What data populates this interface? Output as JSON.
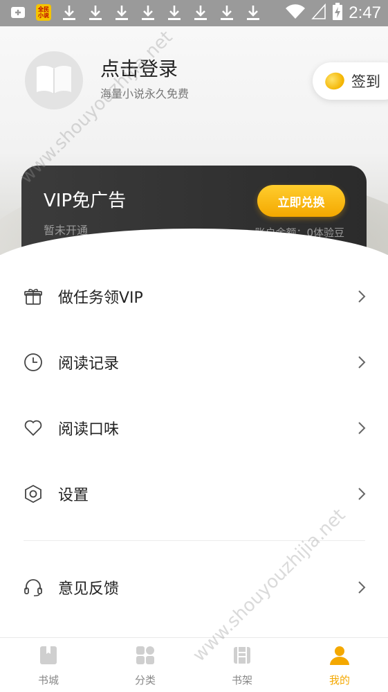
{
  "status_bar": {
    "time": "2:47",
    "app_badge": "全民小说",
    "icons": [
      "add-notification-icon",
      "app-icon",
      "download-icon",
      "download-icon",
      "download-icon",
      "download-icon",
      "download-icon",
      "download-icon",
      "download-icon",
      "download-icon",
      "wifi-icon",
      "signal-icon",
      "battery-charging-icon"
    ]
  },
  "profile": {
    "title": "点击登录",
    "subtitle": "海量小说永久免费",
    "avatar_icon": "book-icon"
  },
  "checkin": {
    "label": "签到",
    "icon": "bean-icon"
  },
  "vip": {
    "title": "VIP免广告",
    "status": "暂未开通",
    "button": "立即兑换",
    "balance": "账户余额：0体验豆"
  },
  "menu": [
    {
      "label": "做任务领VIP",
      "icon": "gift-icon"
    },
    {
      "label": "阅读记录",
      "icon": "clock-icon"
    },
    {
      "label": "阅读口味",
      "icon": "heart-icon"
    },
    {
      "label": "设置",
      "icon": "settings-icon"
    },
    {
      "label": "意见反馈",
      "icon": "headset-icon"
    }
  ],
  "bottom_nav": [
    {
      "label": "书城",
      "icon": "bookstore-icon",
      "active": false
    },
    {
      "label": "分类",
      "icon": "category-icon",
      "active": false
    },
    {
      "label": "书架",
      "icon": "bookshelf-icon",
      "active": false
    },
    {
      "label": "我的",
      "icon": "profile-icon",
      "active": true
    }
  ],
  "colors": {
    "accent": "#f4a800",
    "vip_card": "#2e2e2e"
  },
  "watermark": "www.shouyouzhijia.net"
}
